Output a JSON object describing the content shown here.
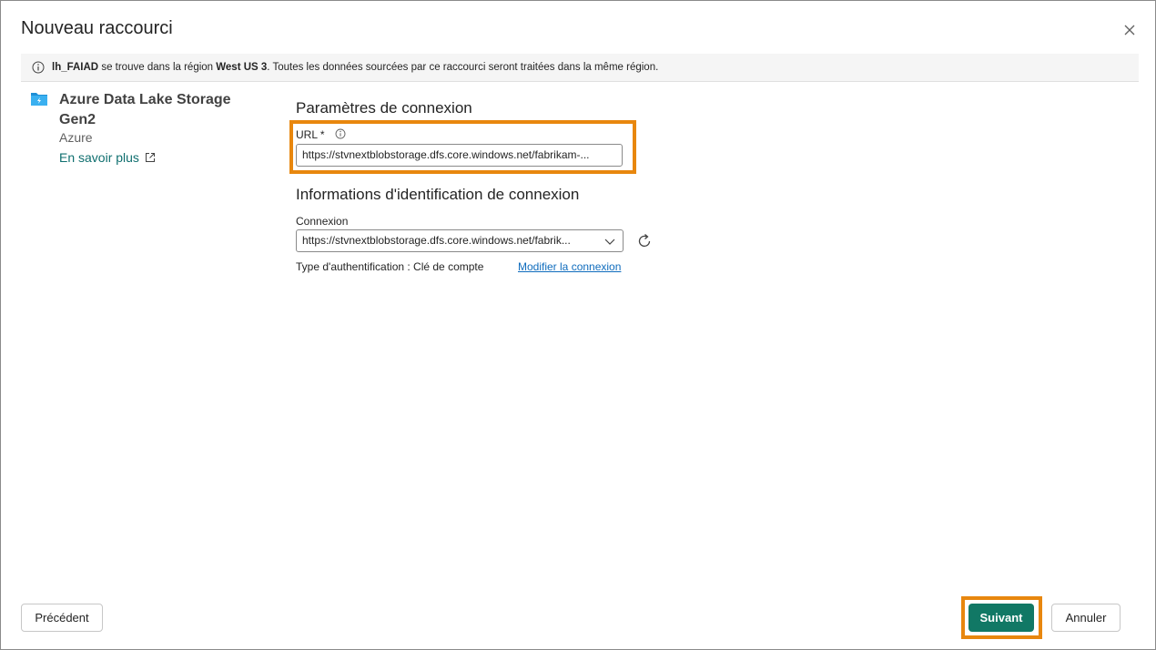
{
  "dialog": {
    "title": "Nouveau raccourci",
    "close_icon": "close-icon"
  },
  "banner": {
    "icon": "info-icon",
    "lakehouse": "lh_FAIAD",
    "text1": " se trouve dans la région ",
    "region": "West US 3",
    "text2": ". Toutes les données sourcées par ce raccourci seront traitées dans la même région."
  },
  "source": {
    "icon": "azure-data-lake-icon",
    "name": "Azure Data Lake Storage Gen2",
    "category": "Azure",
    "learn_more": "En savoir plus",
    "learn_more_icon": "external-link-icon"
  },
  "connection_settings": {
    "heading": "Paramètres de connexion",
    "url_label": "URL",
    "url_required": "*",
    "url_value": "https://stvnextblobstorage.dfs.core.windows.net/fabrikam-..."
  },
  "credentials": {
    "heading": "Informations d'identification de connexion",
    "connection_label": "Connexion",
    "connection_value": "https://stvnextblobstorage.dfs.core.windows.net/fabrik...",
    "auth_text": "Type d'authentification : Clé de compte",
    "modify_link": "Modifier la connexion"
  },
  "footer": {
    "previous": "Précédent",
    "next": "Suivant",
    "cancel": "Annuler"
  },
  "colors": {
    "accent": "#117865",
    "highlight": "#e8870e",
    "link": "#0f6cbd"
  }
}
